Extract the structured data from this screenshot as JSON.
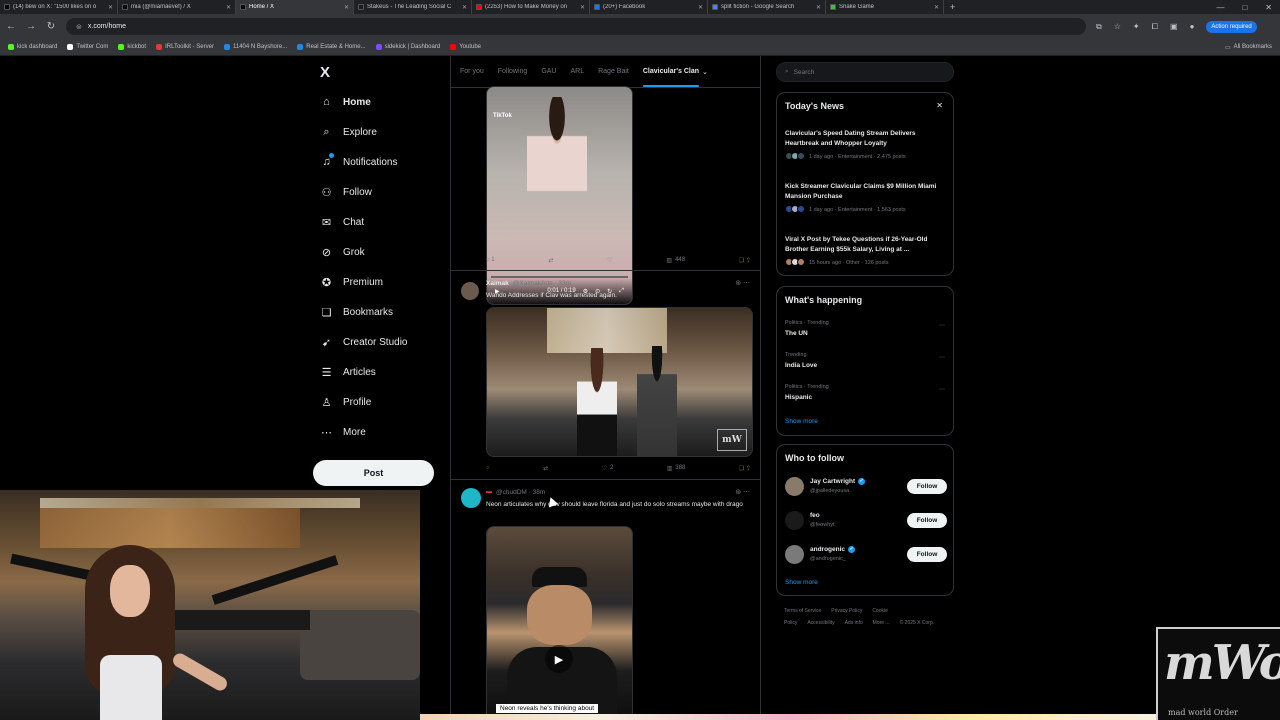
{
  "browser": {
    "tabs": [
      {
        "label": "(14) bew on X: \"1500 likes on o",
        "color": "#000000",
        "active": false
      },
      {
        "label": "mia (@miamaevef) / X",
        "color": "#000000",
        "active": false
      },
      {
        "label": "Home / X",
        "color": "#000000",
        "active": true
      },
      {
        "label": "Stakeus - The Leading Social C",
        "color": "#1c1c1c",
        "active": false
      },
      {
        "label": "(2253) How to Make Money on",
        "color": "#ff0000",
        "active": false
      },
      {
        "label": "(20+) Facebook",
        "color": "#1877f2",
        "active": false
      },
      {
        "label": "split fiction - Google Search",
        "color": "#4285f4",
        "active": false
      },
      {
        "label": "Snake Game",
        "color": "#3fbf3f",
        "active": false
      }
    ],
    "url": "x.com/home",
    "action_required": "Action required",
    "bookmarks": [
      {
        "label": "kick dashboard",
        "color": "#53fc18"
      },
      {
        "label": "Twitter Com",
        "color": "#ffffff"
      },
      {
        "label": "kickbot",
        "color": "#53fc18"
      },
      {
        "label": "IRLToolkit - Server",
        "color": "#e53935"
      },
      {
        "label": "11404 N Bayshore...",
        "color": "#1e88e5"
      },
      {
        "label": "Real Estate & Home...",
        "color": "#1e88e5"
      },
      {
        "label": "sidekick | Dashboard",
        "color": "#7c4dff"
      },
      {
        "label": "Youtube",
        "color": "#ff0000"
      }
    ],
    "all_bookmarks": "All Bookmarks"
  },
  "nav": {
    "logo": "X",
    "items": [
      {
        "label": "Home",
        "icon": "⌂"
      },
      {
        "label": "Explore",
        "icon": "⌕"
      },
      {
        "label": "Notifications",
        "icon": "♫"
      },
      {
        "label": "Follow",
        "icon": "⚇"
      },
      {
        "label": "Chat",
        "icon": "✉"
      },
      {
        "label": "Grok",
        "icon": "⊘"
      },
      {
        "label": "Premium",
        "icon": "✪"
      },
      {
        "label": "Bookmarks",
        "icon": "❏"
      },
      {
        "label": "Creator Studio",
        "icon": "➹"
      },
      {
        "label": "Articles",
        "icon": "☰"
      },
      {
        "label": "Profile",
        "icon": "♙"
      },
      {
        "label": "More",
        "icon": "⋯"
      }
    ],
    "post_button": "Post"
  },
  "feed": {
    "tabs": [
      "For you",
      "Following",
      "GAU",
      "ARL",
      "Rage Bait",
      "Clavicular's Clan"
    ],
    "post1": {
      "media_tag": "TikTok",
      "time": "0:01 / 0:19",
      "likes": "",
      "views": "448"
    },
    "post2": {
      "name": "Xaimak",
      "handle": "@XaimakArts · 33m",
      "text": "Wando Addresses if Clav was arrested again.",
      "replies": "",
      "likes": "2",
      "views": "388"
    },
    "post3": {
      "handle": "@chudDM · 38m",
      "text": "Neon articulates why clav should leave florida and just do solo streams maybe with drago",
      "caption": "Neon reveals he's thinking about"
    }
  },
  "sidebar": {
    "search_placeholder": "Search",
    "news": {
      "title": "Today's News",
      "items": [
        {
          "title": "Clavicular's Speed Dating Stream Delivers Heartbreak and Whopper Loyalty",
          "meta": "1 day ago · Entertainment · 2,475 posts"
        },
        {
          "title": "Kick Streamer Clavicular Claims $9 Million Miami Mansion Purchase",
          "meta": "1 day ago · Entertainment · 1,563 posts"
        },
        {
          "title": "Viral X Post by Tekee Questions if 26-Year-Old Brother Earning $55k Salary, Living at ...",
          "meta": "15 hours ago · Other · 126 posts"
        }
      ]
    },
    "happening": {
      "title": "What's happening",
      "items": [
        {
          "category": "Politics · Trending",
          "name": "The UN"
        },
        {
          "category": "Trending",
          "name": "India Love"
        },
        {
          "category": "Politics · Trending",
          "name": "Hispanic"
        }
      ],
      "show_more": "Show more"
    },
    "who_to_follow": {
      "title": "Who to follow",
      "users": [
        {
          "name": "Jay Cartwright",
          "handle": "@jpalledeyousa",
          "verified": true
        },
        {
          "name": "feo",
          "handle": "@feowhyt",
          "verified": false
        },
        {
          "name": "androgenic",
          "handle": "@androgenic_",
          "verified": true
        }
      ],
      "follow_label": "Follow",
      "show_more": "Show more"
    },
    "footer": [
      "Terms of Service",
      "Privacy Policy",
      "Cookie Policy",
      "Accessibility",
      "Ads info",
      "More ...",
      "© 2025 X Corp."
    ]
  },
  "overlay": {
    "logo_big": "mWo",
    "logo_small": "mad world Order"
  }
}
